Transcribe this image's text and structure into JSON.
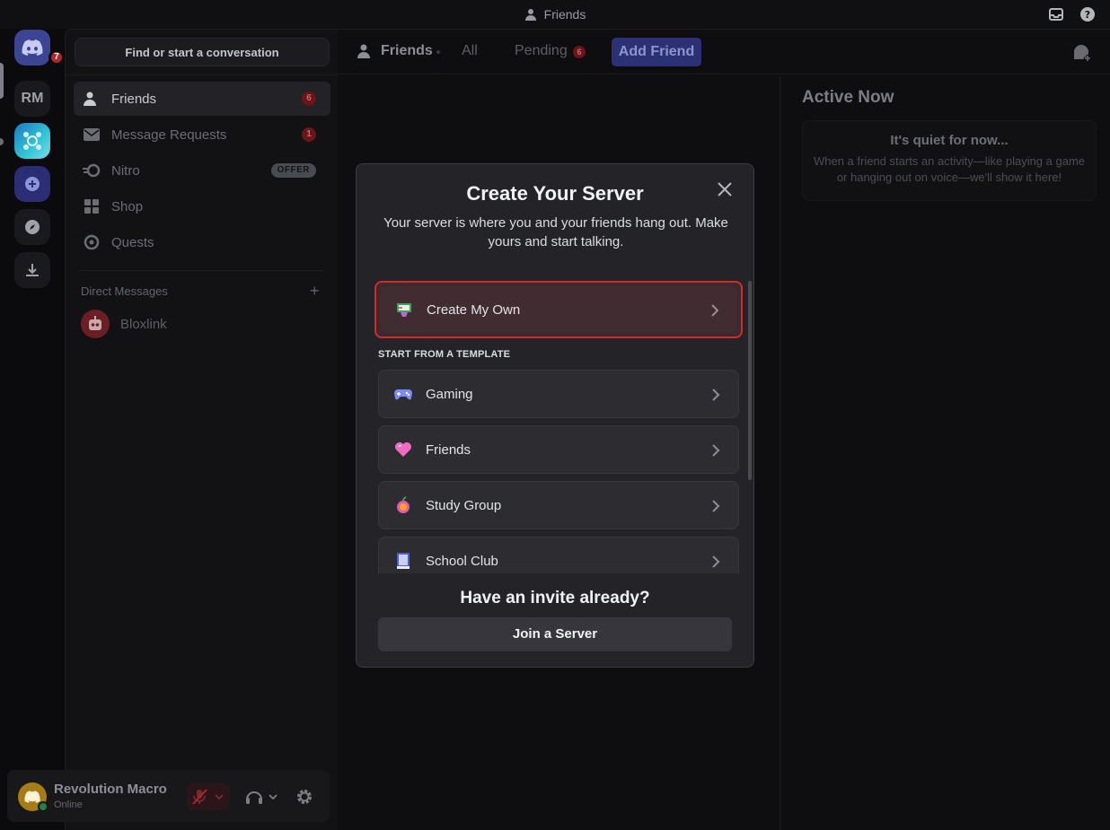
{
  "window": {
    "title": "Friends"
  },
  "rail": {
    "home_badge": "7",
    "rm_label": "RM"
  },
  "sidebar": {
    "search_placeholder": "Find or start a conversation",
    "nav": [
      {
        "label": "Friends",
        "badge": "6"
      },
      {
        "label": "Message Requests",
        "badge": "1"
      },
      {
        "label": "Nitro",
        "tag": "OFFER"
      },
      {
        "label": "Shop"
      },
      {
        "label": "Quests"
      }
    ],
    "dm_header": "Direct Messages",
    "dm_add": "+",
    "dms": [
      {
        "name": "Bloxlink"
      }
    ]
  },
  "user": {
    "name": "Revolution Macro",
    "status": "Online"
  },
  "topbar": {
    "friends_label": "Friends",
    "tab_all": "All",
    "tab_pending": "Pending",
    "pending_badge": "6",
    "add_friend": "Add Friend"
  },
  "active_now": {
    "title": "Active Now",
    "empty_title": "It's quiet for now...",
    "empty_text": "When a friend starts an activity—like playing a game or hanging out on voice—we'll show it here!"
  },
  "modal": {
    "title": "Create Your Server",
    "description": "Your server is where you and your friends hang out. Make yours and start talking.",
    "create_own": "Create My Own",
    "template_header": "START FROM A TEMPLATE",
    "templates": [
      {
        "label": "Gaming",
        "icon": "gamepad-icon"
      },
      {
        "label": "Friends",
        "icon": "heart-icon"
      },
      {
        "label": "Study Group",
        "icon": "apple-icon"
      },
      {
        "label": "School Club",
        "icon": "book-icon"
      }
    ],
    "invite_title": "Have an invite already?",
    "join_button": "Join a Server"
  },
  "colors": {
    "accent": "#5865f2",
    "danger": "#da373c",
    "highlight_border": "#d42a2a"
  }
}
